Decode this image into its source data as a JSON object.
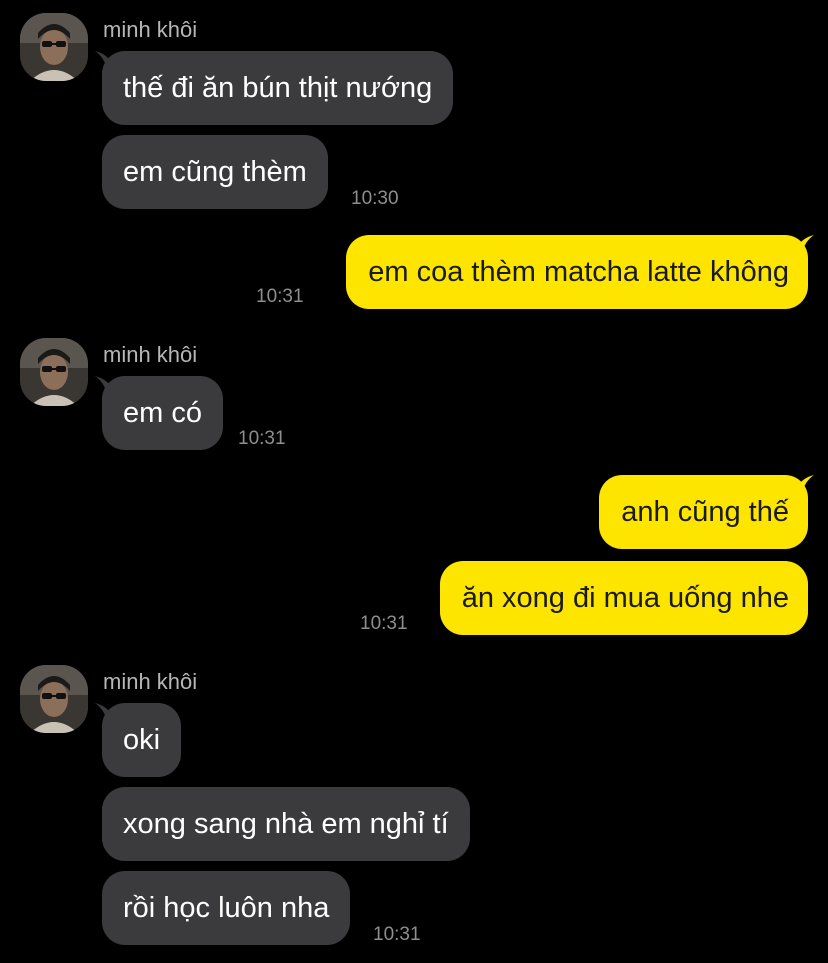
{
  "colors": {
    "background": "#000000",
    "incoming_bubble": "#3b3b3d",
    "outgoing_bubble": "#fee500",
    "sender_name": "#b6b6b6",
    "timestamp": "#8e8e8e"
  },
  "contact": {
    "name": "minh khôi",
    "avatar_icon": "profile-photo-icon"
  },
  "messages": [
    {
      "direction": "in",
      "text": "thế đi ăn bún thịt nướng"
    },
    {
      "direction": "in",
      "text": "em cũng thèm",
      "time": "10:30"
    },
    {
      "direction": "out",
      "text": "em coa thèm matcha latte không",
      "time": "10:31"
    },
    {
      "direction": "in",
      "text": "em có",
      "time": "10:31"
    },
    {
      "direction": "out",
      "text": "anh cũng thế"
    },
    {
      "direction": "out",
      "text": "ăn xong đi mua uống nhe",
      "time": "10:31"
    },
    {
      "direction": "in",
      "text": "oki"
    },
    {
      "direction": "in",
      "text": "xong sang nhà em nghỉ tí"
    },
    {
      "direction": "in",
      "text": "rồi học luôn nha",
      "time": "10:31"
    }
  ]
}
